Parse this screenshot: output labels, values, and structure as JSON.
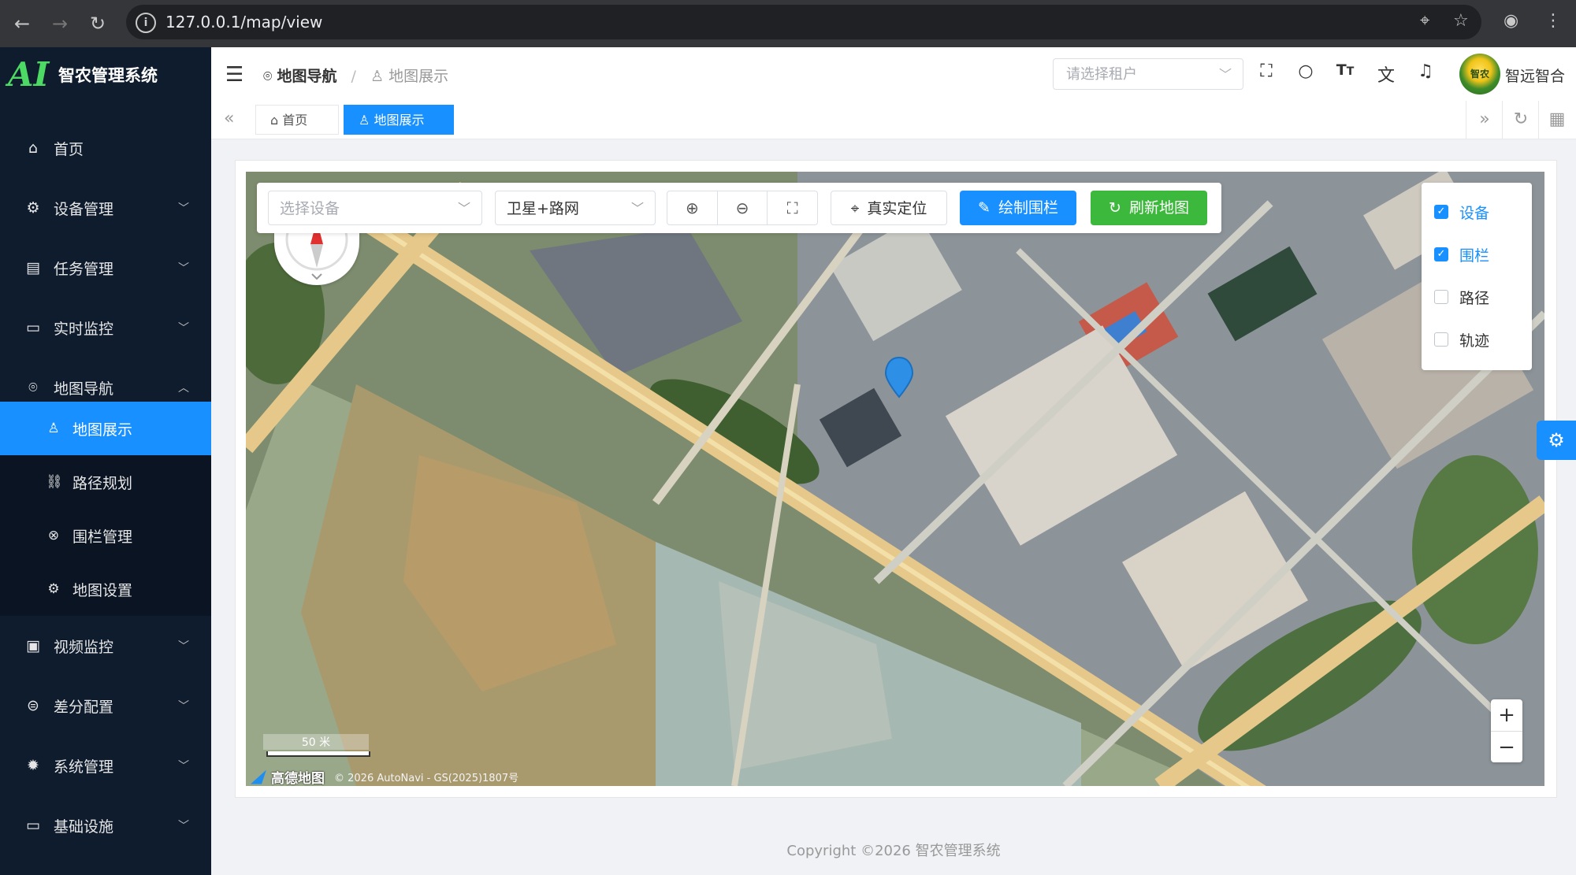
{
  "browser": {
    "url": "127.0.0.1/map/view"
  },
  "sidebar": {
    "app_title": "智农管理系统",
    "items": [
      {
        "label": "首页",
        "icon": "home-icon"
      },
      {
        "label": "设备管理",
        "icon": "chip-icon"
      },
      {
        "label": "任务管理",
        "icon": "document-icon"
      },
      {
        "label": "实时监控",
        "icon": "monitor-icon"
      },
      {
        "label": "地图导航",
        "icon": "map-pin-icon"
      },
      {
        "label": "视频监控",
        "icon": "video-icon"
      },
      {
        "label": "差分配置",
        "icon": "link-icon"
      },
      {
        "label": "系统管理",
        "icon": "gear-icon"
      },
      {
        "label": "基础设施",
        "icon": "monitor-icon"
      }
    ],
    "submenu": [
      {
        "label": "地图展示",
        "icon": "user-pin-icon",
        "active": true
      },
      {
        "label": "路径规划",
        "icon": "route-icon"
      },
      {
        "label": "围栏管理",
        "icon": "circle-x-icon"
      },
      {
        "label": "地图设置",
        "icon": "gear-icon"
      }
    ]
  },
  "header": {
    "breadcrumb_parent": "地图导航",
    "breadcrumb_separator": "/",
    "breadcrumb_current": "地图展示",
    "tenant_placeholder": "请选择租户",
    "user_name": "智远智合",
    "avatar_text": "智农"
  },
  "tabs": [
    {
      "label": "首页",
      "active": false
    },
    {
      "label": "地图展示",
      "active": true
    }
  ],
  "toolbar": {
    "device_placeholder": "选择设备",
    "map_type": "卫星+路网",
    "locate_label": "真实定位",
    "draw_fence_label": "绘制围栏",
    "refresh_label": "刷新地图"
  },
  "layers": [
    {
      "label": "设备",
      "checked": true
    },
    {
      "label": "围栏",
      "checked": true
    },
    {
      "label": "路径",
      "checked": false
    },
    {
      "label": "轨迹",
      "checked": false
    }
  ],
  "map": {
    "scale_label": "50 米",
    "provider": "高德地图",
    "copyright": "© 2026 AutoNavi - GS(2025)1807号",
    "zoom_in": "+",
    "zoom_out": "−"
  },
  "footer": {
    "copyright": "Copyright ©2026 智农管理系统"
  },
  "colors": {
    "primary": "#1890ff",
    "success": "#3cb93c",
    "sidebar_bg": "#0f1c2e"
  }
}
